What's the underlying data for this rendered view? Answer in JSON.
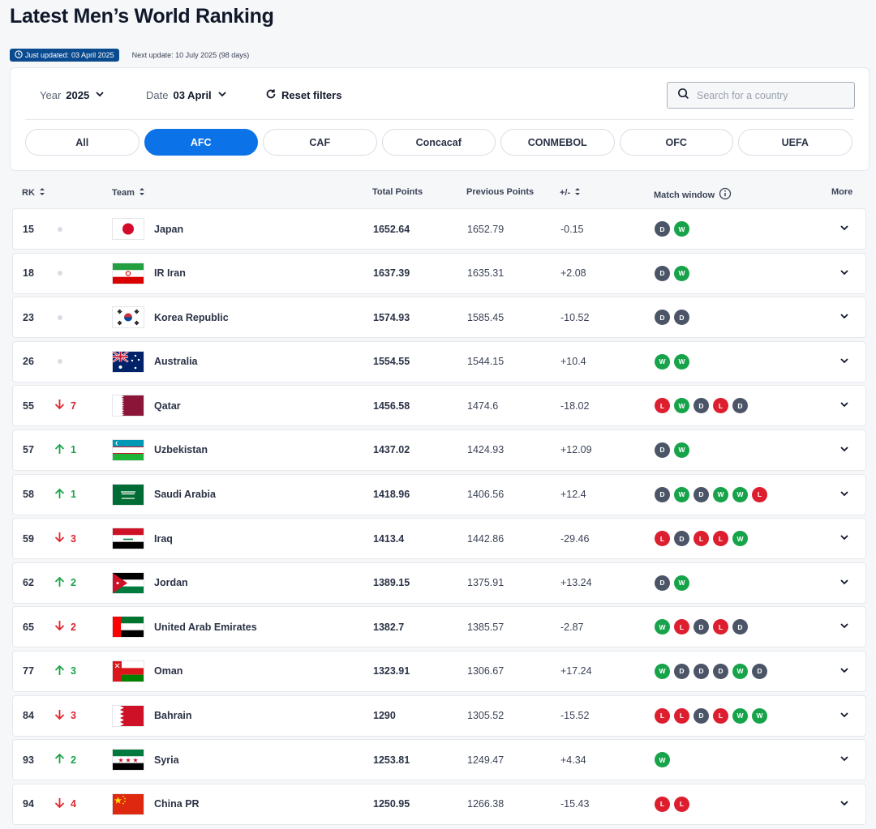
{
  "page": {
    "title": "Latest Men’s World Ranking",
    "updated_label": "Just updated:",
    "updated_date": "03 April 2025",
    "next_label": "Next update:",
    "next_date": "10 July 2025 (98 days)"
  },
  "filters": {
    "year_label": "Year",
    "year_value": "2025",
    "date_label": "Date",
    "date_value": "03 April",
    "reset_label": "Reset filters",
    "search_placeholder": "Search for a country"
  },
  "confederations": [
    {
      "label": "All",
      "active": false
    },
    {
      "label": "AFC",
      "active": true
    },
    {
      "label": "CAF",
      "active": false
    },
    {
      "label": "Concacaf",
      "active": false
    },
    {
      "label": "CONMEBOL",
      "active": false
    },
    {
      "label": "OFC",
      "active": false
    },
    {
      "label": "UEFA",
      "active": false
    }
  ],
  "table": {
    "columns": {
      "rank": "RK",
      "team": "Team",
      "total": "Total Points",
      "previous": "Previous Points",
      "diff": "+/-",
      "window": "Match window",
      "more": "More"
    },
    "colors": {
      "win": "#17a34a",
      "loss": "#dd1e2f",
      "draw": "#4b5567",
      "accent": "#0b72e7"
    },
    "rows": [
      {
        "rank": "15",
        "move_dir": "none",
        "move": "",
        "flag": "japan",
        "team": "Japan",
        "total": "1652.64",
        "previous": "1652.79",
        "diff": "-0.15",
        "window": [
          "D",
          "W"
        ]
      },
      {
        "rank": "18",
        "move_dir": "none",
        "move": "",
        "flag": "iran",
        "team": "IR Iran",
        "total": "1637.39",
        "previous": "1635.31",
        "diff": "+2.08",
        "window": [
          "D",
          "W"
        ]
      },
      {
        "rank": "23",
        "move_dir": "none",
        "move": "",
        "flag": "korea",
        "team": "Korea Republic",
        "total": "1574.93",
        "previous": "1585.45",
        "diff": "-10.52",
        "window": [
          "D",
          "D"
        ]
      },
      {
        "rank": "26",
        "move_dir": "none",
        "move": "",
        "flag": "australia",
        "team": "Australia",
        "total": "1554.55",
        "previous": "1544.15",
        "diff": "+10.4",
        "window": [
          "W",
          "W"
        ]
      },
      {
        "rank": "55",
        "move_dir": "down",
        "move": "7",
        "flag": "qatar",
        "team": "Qatar",
        "total": "1456.58",
        "previous": "1474.6",
        "diff": "-18.02",
        "window": [
          "L",
          "W",
          "D",
          "L",
          "D"
        ]
      },
      {
        "rank": "57",
        "move_dir": "up",
        "move": "1",
        "flag": "uzbekistan",
        "team": "Uzbekistan",
        "total": "1437.02",
        "previous": "1424.93",
        "diff": "+12.09",
        "window": [
          "D",
          "W"
        ]
      },
      {
        "rank": "58",
        "move_dir": "up",
        "move": "1",
        "flag": "saudi",
        "team": "Saudi Arabia",
        "total": "1418.96",
        "previous": "1406.56",
        "diff": "+12.4",
        "window": [
          "D",
          "W",
          "D",
          "W",
          "W",
          "L"
        ]
      },
      {
        "rank": "59",
        "move_dir": "down",
        "move": "3",
        "flag": "iraq",
        "team": "Iraq",
        "total": "1413.4",
        "previous": "1442.86",
        "diff": "-29.46",
        "window": [
          "L",
          "D",
          "L",
          "L",
          "W"
        ]
      },
      {
        "rank": "62",
        "move_dir": "up",
        "move": "2",
        "flag": "jordan",
        "team": "Jordan",
        "total": "1389.15",
        "previous": "1375.91",
        "diff": "+13.24",
        "window": [
          "D",
          "W"
        ]
      },
      {
        "rank": "65",
        "move_dir": "down",
        "move": "2",
        "flag": "uae",
        "team": "United Arab Emirates",
        "total": "1382.7",
        "previous": "1385.57",
        "diff": "-2.87",
        "window": [
          "W",
          "L",
          "D",
          "L",
          "D"
        ]
      },
      {
        "rank": "77",
        "move_dir": "up",
        "move": "3",
        "flag": "oman",
        "team": "Oman",
        "total": "1323.91",
        "previous": "1306.67",
        "diff": "+17.24",
        "window": [
          "W",
          "D",
          "D",
          "D",
          "W",
          "D"
        ]
      },
      {
        "rank": "84",
        "move_dir": "down",
        "move": "3",
        "flag": "bahrain",
        "team": "Bahrain",
        "total": "1290",
        "previous": "1305.52",
        "diff": "-15.52",
        "window": [
          "L",
          "L",
          "D",
          "L",
          "W",
          "W"
        ]
      },
      {
        "rank": "93",
        "move_dir": "up",
        "move": "2",
        "flag": "syria",
        "team": "Syria",
        "total": "1253.81",
        "previous": "1249.47",
        "diff": "+4.34",
        "window": [
          "W"
        ]
      },
      {
        "rank": "94",
        "move_dir": "down",
        "move": "4",
        "flag": "china",
        "team": "China PR",
        "total": "1250.95",
        "previous": "1266.38",
        "diff": "-15.43",
        "window": [
          "L",
          "L"
        ]
      }
    ]
  }
}
